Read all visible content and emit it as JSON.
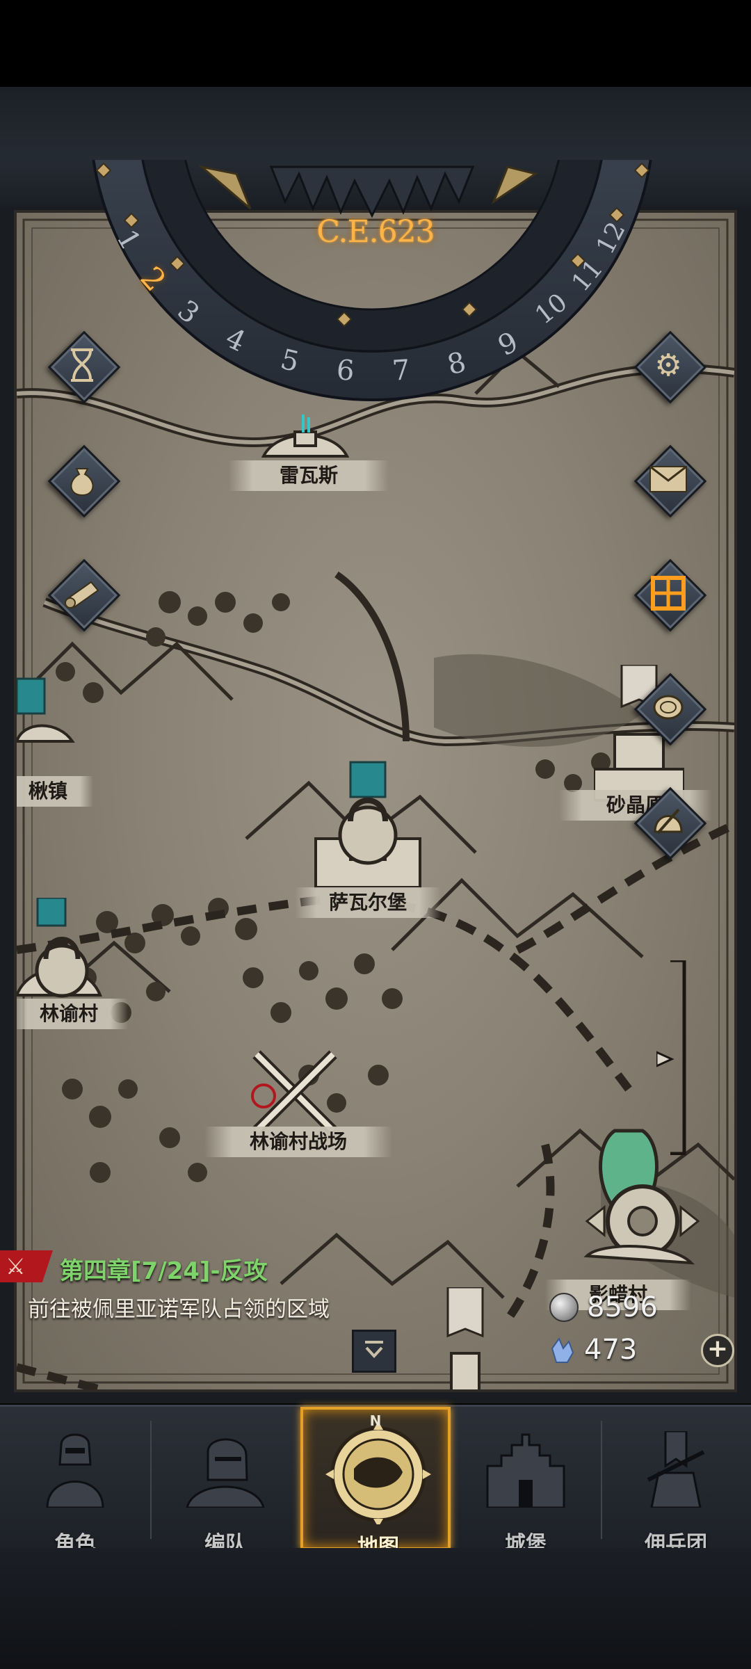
{
  "calendar": {
    "era": "C.E.623",
    "months": [
      "1",
      "2",
      "3",
      "4",
      "5",
      "6",
      "7",
      "8",
      "9",
      "10",
      "11",
      "12"
    ],
    "current_month": "2"
  },
  "side_buttons_left": [
    {
      "name": "hourglass-icon"
    },
    {
      "name": "money-bag-icon"
    },
    {
      "name": "scroll-icon"
    }
  ],
  "side_buttons_right": [
    {
      "name": "gear-icon"
    },
    {
      "name": "mail-icon"
    },
    {
      "name": "calendar-grid-icon"
    },
    {
      "name": "coin-stack-icon"
    },
    {
      "name": "helmet-icon"
    }
  ],
  "locations": {
    "leiwasi": "雷瓦斯",
    "qiuzhen": "楸镇",
    "saval": "萨瓦尔堡",
    "shajing": "砂晶原",
    "linyu": "林谕村",
    "battlefield": "林谕村战场",
    "yingla": "影蜡村"
  },
  "quest": {
    "title": "第四章[7/24]-反攻",
    "description": "前往被佩里亚诺军队占领的区域"
  },
  "resources": {
    "silver": "8596",
    "crystal": "473"
  },
  "nav": [
    {
      "label": "角色",
      "icon": "knight-icon"
    },
    {
      "label": "编队",
      "icon": "helmet-squad-icon"
    },
    {
      "label": "地图",
      "icon": "compass-map-icon",
      "active": true
    },
    {
      "label": "城堡",
      "icon": "castle-icon"
    },
    {
      "label": "佣兵团",
      "icon": "banner-tower-icon"
    }
  ],
  "compass_letter": "N",
  "colors": {
    "accent": "#e5a02a",
    "quest_title": "#7fd36b",
    "era": "#ffb347"
  }
}
